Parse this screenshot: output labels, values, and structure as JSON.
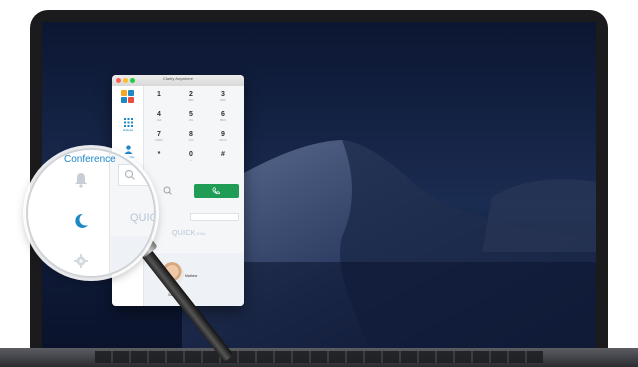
{
  "window": {
    "title": "Clarity Anywhere"
  },
  "sidebar": {
    "items": [
      {
        "label": "Dialpad",
        "icon": "dialpad-icon"
      },
      {
        "label": "Contacts",
        "icon": "contacts-icon"
      },
      {
        "label": "Conference",
        "icon": "conference-icon"
      }
    ]
  },
  "dialpad": {
    "keys": [
      {
        "digit": "1",
        "letters": ""
      },
      {
        "digit": "2",
        "letters": "ABC"
      },
      {
        "digit": "3",
        "letters": "DEF"
      },
      {
        "digit": "4",
        "letters": "GHI"
      },
      {
        "digit": "5",
        "letters": "JKL"
      },
      {
        "digit": "6",
        "letters": "MNO"
      },
      {
        "digit": "7",
        "letters": "PQRS"
      },
      {
        "digit": "8",
        "letters": "TUV"
      },
      {
        "digit": "9",
        "letters": "WXYZ"
      },
      {
        "digit": "*",
        "letters": ""
      },
      {
        "digit": "0",
        "letters": "+"
      },
      {
        "digit": "#",
        "letters": ""
      }
    ]
  },
  "quick_dial": {
    "prefix": "QUICK",
    "rest": "DIAL"
  },
  "contacts": [
    {
      "name": "Mathew"
    },
    {
      "name": "Sasia Sh"
    }
  ],
  "magnifier": {
    "conference_label": "Conference"
  },
  "colors": {
    "accent": "#1e88c7",
    "call_green": "#1f9d57",
    "wallpaper_dark": "#0e1a33"
  }
}
